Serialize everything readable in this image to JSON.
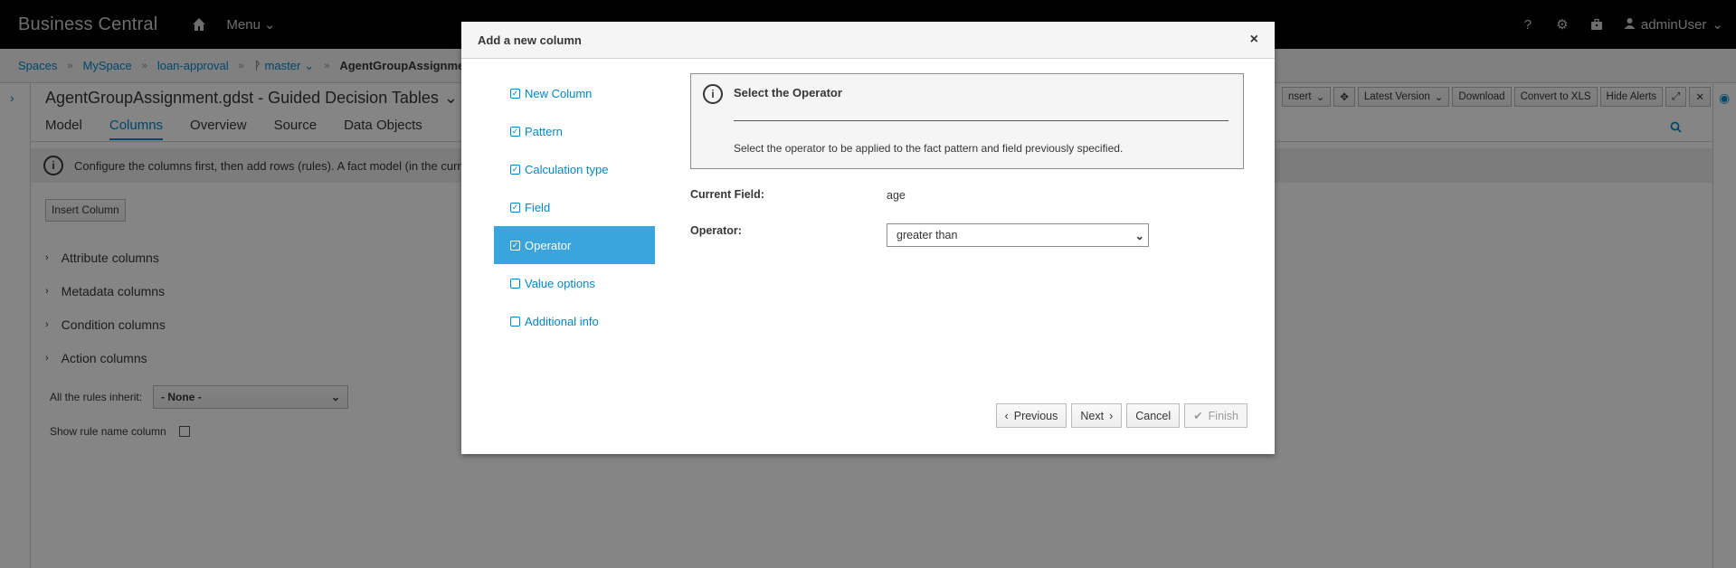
{
  "app": {
    "brand": "Business Central",
    "menu_label": "Menu"
  },
  "topbar": {
    "help": "?",
    "user": "adminUser"
  },
  "breadcrumb": {
    "items": [
      "Spaces",
      "MySpace",
      "loan-approval",
      "master"
    ],
    "current": "AgentGroupAssignment"
  },
  "editor": {
    "title": "AgentGroupAssignment.gdst - Guided Decision Tables",
    "tabs": [
      "Model",
      "Columns",
      "Overview",
      "Source",
      "Data Objects"
    ],
    "active_tab": "Columns",
    "toolbar": {
      "insert": "nsert",
      "latest_version": "Latest Version",
      "download": "Download",
      "convert": "Convert to XLS",
      "hide_alerts": "Hide Alerts"
    },
    "info": "Configure the columns first, then add rows (rules). A fact model (in the curren",
    "insert_column": "Insert Column",
    "accordion": [
      "Attribute columns",
      "Metadata columns",
      "Condition columns",
      "Action columns"
    ],
    "inherit_label": "All the rules inherit:",
    "inherit_value": "- None -",
    "show_rule_name": "Show rule name column"
  },
  "modal": {
    "title": "Add a new column",
    "close": "×",
    "steps": [
      {
        "label": "New Column",
        "done": true
      },
      {
        "label": "Pattern",
        "done": true
      },
      {
        "label": "Calculation type",
        "done": true
      },
      {
        "label": "Field",
        "done": true
      },
      {
        "label": "Operator",
        "done": true
      },
      {
        "label": "Value options",
        "done": false
      },
      {
        "label": "Additional info",
        "done": false
      }
    ],
    "active_step": "Operator",
    "panel_title": "Select the Operator",
    "panel_desc": "Select the operator to be applied to the fact pattern and field previously specified.",
    "current_field_label": "Current Field:",
    "current_field_value": "age",
    "operator_label": "Operator:",
    "operator_value": "greater than",
    "buttons": {
      "previous": "Previous",
      "next": "Next",
      "cancel": "Cancel",
      "finish": "Finish"
    }
  },
  "colors": {
    "accent": "#0088ce",
    "active_step_bg": "#39a5dc",
    "topbar_bg": "#030303"
  }
}
